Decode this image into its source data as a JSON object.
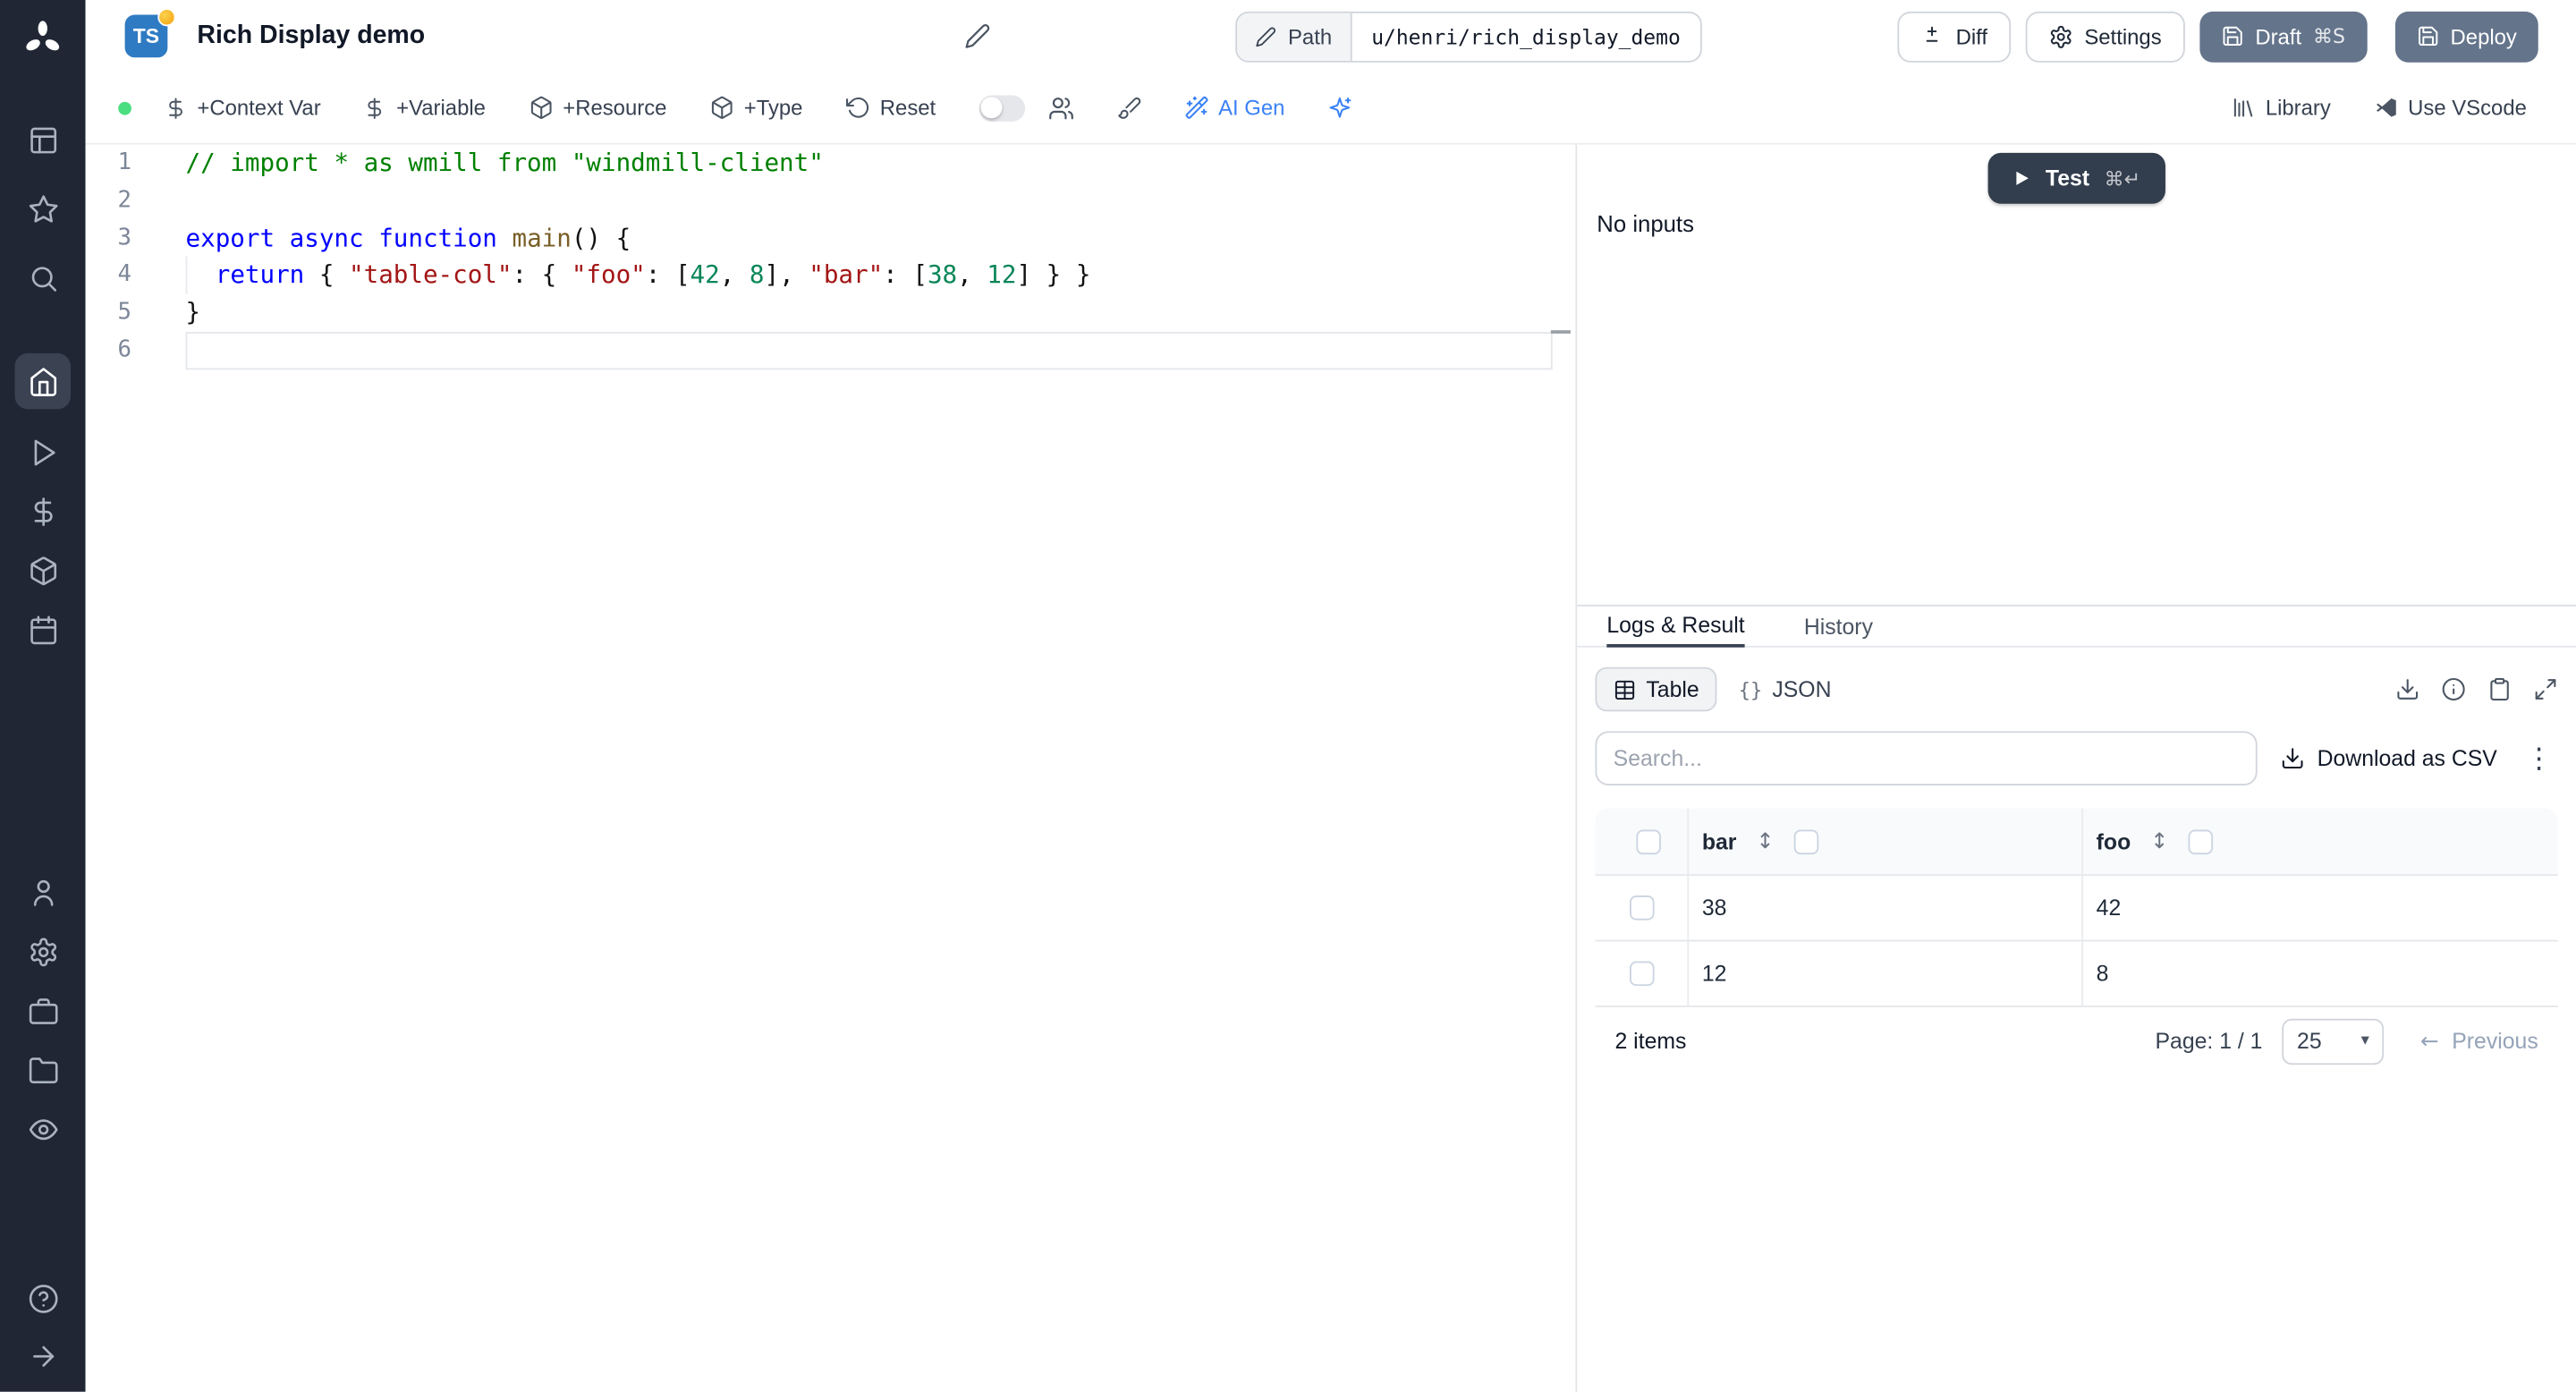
{
  "colors": {
    "accent": "#3b82f6",
    "sidebar_bg": "#202633",
    "slate_button": "#64748b",
    "test_button": "#323d4d",
    "syntax_comment": "#008000",
    "syntax_keyword": "#0000ff",
    "syntax_string": "#a31515",
    "syntax_number": "#098658"
  },
  "topbar": {
    "ts_badge": "TS",
    "title": "Rich Display demo",
    "path_label": "Path",
    "path_value": "u/henri/rich_display_demo",
    "diff_label": "Diff",
    "settings_label": "Settings",
    "draft_label": "Draft",
    "draft_shortcut": "⌘S",
    "deploy_label": "Deploy"
  },
  "toolbar": {
    "context_var": "+Context Var",
    "variable": "+Variable",
    "resource": "+Resource",
    "type": "+Type",
    "reset": "Reset",
    "ai_gen": "AI Gen",
    "library": "Library",
    "vscode": "Use VScode"
  },
  "editor": {
    "lines": [
      {
        "no": "1",
        "tokens": [
          [
            "comment",
            "// import * as wmill from \"windmill-client\""
          ]
        ]
      },
      {
        "no": "2",
        "tokens": []
      },
      {
        "no": "3",
        "tokens": [
          [
            "keyword",
            "export"
          ],
          [
            "plain",
            " "
          ],
          [
            "keyword",
            "async"
          ],
          [
            "plain",
            " "
          ],
          [
            "keyword",
            "function"
          ],
          [
            "plain",
            " "
          ],
          [
            "fn",
            "main"
          ],
          [
            "plain",
            "() {"
          ]
        ]
      },
      {
        "no": "4",
        "guide": true,
        "tokens": [
          [
            "plain",
            "  "
          ],
          [
            "keyword",
            "return"
          ],
          [
            "plain",
            " { "
          ],
          [
            "string",
            "\"table-col\""
          ],
          [
            "plain",
            ": { "
          ],
          [
            "string",
            "\"foo\""
          ],
          [
            "plain",
            ": ["
          ],
          [
            "number",
            "42"
          ],
          [
            "plain",
            ", "
          ],
          [
            "number",
            "8"
          ],
          [
            "plain",
            "], "
          ],
          [
            "string",
            "\"bar\""
          ],
          [
            "plain",
            ": ["
          ],
          [
            "number",
            "38"
          ],
          [
            "plain",
            ", "
          ],
          [
            "number",
            "12"
          ],
          [
            "plain",
            "] } }"
          ]
        ]
      },
      {
        "no": "5",
        "tokens": [
          [
            "plain",
            "}"
          ]
        ]
      },
      {
        "no": "6",
        "current": true,
        "tokens": []
      }
    ]
  },
  "run_panel": {
    "test_label": "Test",
    "test_shortcut": "⌘↵",
    "no_inputs": "No inputs"
  },
  "result_panel": {
    "tabs": [
      {
        "label": "Logs & Result",
        "active": true
      },
      {
        "label": "History",
        "active": false
      }
    ],
    "view_table": "Table",
    "view_json": "JSON",
    "json_glyph": "{}",
    "search_placeholder": "Search...",
    "download_csv": "Download as CSV",
    "kebab_glyph": "⋮",
    "table": {
      "columns": [
        "bar",
        "foo"
      ],
      "rows": [
        [
          "38",
          "42"
        ],
        [
          "12",
          "8"
        ]
      ],
      "sort_glyph": "↕",
      "items_count": "2 items",
      "page_info": "Page: 1 / 1",
      "page_size": "25",
      "chevron_glyph": "▾",
      "prev_arrow": "←",
      "previous_label": "Previous"
    }
  },
  "sidebar": {
    "icon_names": [
      "windmill-logo",
      "grid",
      "star",
      "search",
      "home",
      "play",
      "dollar",
      "package",
      "calendar",
      "user",
      "gear",
      "briefcase",
      "folder",
      "eye",
      "help",
      "arrow-right"
    ]
  }
}
